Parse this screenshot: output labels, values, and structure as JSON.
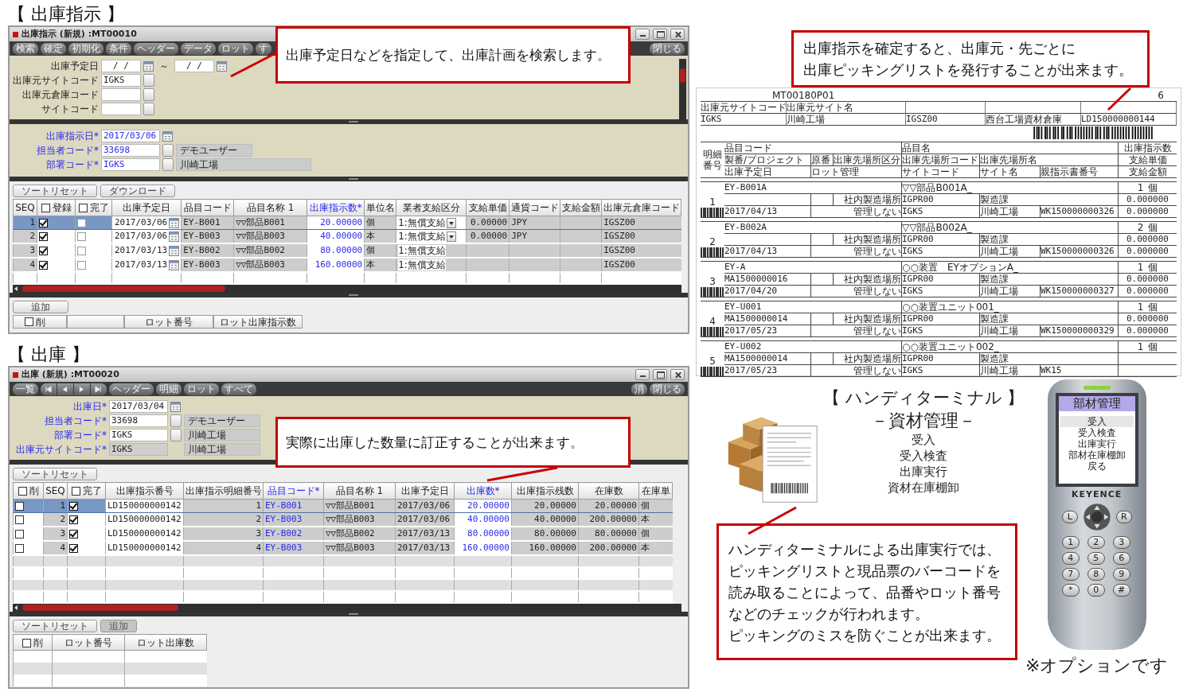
{
  "instruction": {
    "heading": "【 出庫指示 】",
    "title": "出庫指示 (新規) :MT00010",
    "toolbar": [
      "検索",
      "確定",
      "初期化",
      "条件",
      "ヘッダー",
      "データ",
      "ロット",
      "す"
    ],
    "close_button": "閉じる",
    "search_fields": [
      {
        "kind": "range",
        "label": "出庫予定日",
        "value": "/ /",
        "separator": "～",
        "value_to": "/ /"
      },
      {
        "kind": "lookup",
        "label": "出庫元サイトコード",
        "value": "IGKS"
      },
      {
        "kind": "lookup",
        "label": "出庫元倉庫コード"
      },
      {
        "kind": "lookup",
        "label": "サイトコード"
      }
    ],
    "header_fields": [
      {
        "kind": "date",
        "label": "出庫指示日*",
        "value": "2017/03/06"
      },
      {
        "kind": "lookup",
        "label": "担当者コード*",
        "value": "33698",
        "name": "デモユーザー"
      },
      {
        "kind": "lookup",
        "label": "部署コード*",
        "value": "IGKS",
        "name": "川崎工場"
      }
    ],
    "grid_buttons": [
      "ソートリセット",
      "ダウンロード"
    ],
    "columns": [
      {
        "kind": "text",
        "label": "SEQ",
        "required": false
      },
      {
        "kind": "check",
        "label": "登録",
        "checked": false,
        "required": false
      },
      {
        "kind": "check",
        "label": "完了",
        "checked": false,
        "required": false
      },
      {
        "kind": "text",
        "label": "出庫予定日",
        "required": false
      },
      {
        "kind": "text",
        "label": "品目コード",
        "required": false
      },
      {
        "kind": "text",
        "label": "品目名称 1",
        "required": false
      },
      {
        "kind": "text",
        "label": "出庫指示数*",
        "required": true
      },
      {
        "kind": "text",
        "label": "単位名",
        "required": false
      },
      {
        "kind": "text",
        "label": "業者支給区分",
        "required": false
      },
      {
        "kind": "text",
        "label": "支給単価",
        "required": false
      },
      {
        "kind": "text",
        "label": "通貨コード",
        "required": false
      },
      {
        "kind": "text",
        "label": "支給金額",
        "required": false
      },
      {
        "kind": "text",
        "label": "出庫元倉庫コード",
        "required": false
      }
    ],
    "rows": [
      {
        "selected": true,
        "seq": "1",
        "registered": true,
        "done": false,
        "date": "2017/03/06",
        "item_code": "EY-B001",
        "item_name": "▽▽部品B001",
        "quantity": "20.00000",
        "unit": "個",
        "supply_type": "1:無償支給",
        "dropdown": true,
        "unit_price": "0.00000",
        "currency": "JPY",
        "warehouse": "IGSZ00"
      },
      {
        "selected": false,
        "seq": "2",
        "registered": true,
        "done": false,
        "date": "2017/03/06",
        "item_code": "EY-B003",
        "item_name": "▽▽部品B003",
        "quantity": "40.00000",
        "unit": "本",
        "supply_type": "1:無償支給",
        "dropdown": true,
        "unit_price": "0.00000",
        "currency": "JPY",
        "warehouse": "IGSZ00"
      },
      {
        "selected": false,
        "seq": "3",
        "registered": true,
        "done": false,
        "date": "2017/03/13",
        "item_code": "EY-B002",
        "item_name": "▽▽部品B002",
        "quantity": "80.00000",
        "unit": "個",
        "supply_type": "1:無償支給",
        "dropdown": false,
        "warehouse": "IGSZ00"
      },
      {
        "selected": false,
        "seq": "4",
        "registered": true,
        "done": false,
        "date": "2017/03/13",
        "item_code": "EY-B003",
        "item_name": "▽▽部品B003",
        "quantity": "160.00000",
        "unit": "本",
        "supply_type": "1:無償支給",
        "dropdown": false,
        "warehouse": "IGSZ00"
      }
    ],
    "add_button": "追加",
    "lot_columns": [
      {
        "kind": "check",
        "label": "削",
        "checked": false
      },
      {
        "kind": "blank"
      },
      {
        "kind": "text",
        "label": "ロット番号"
      },
      {
        "kind": "text",
        "label": "ロット出庫指示数"
      }
    ]
  },
  "shipping": {
    "heading": "【 出庫 】",
    "title": "出庫 (新規) :MT00020",
    "toolbar": [
      "一覧"
    ],
    "toolbar_more": [
      "ヘッダー",
      "明細",
      "ロット",
      "すべて"
    ],
    "right_buttons": [
      "消",
      "閉じる"
    ],
    "fields": [
      {
        "kind": "date",
        "label": "出庫日*",
        "value": "2017/03/04"
      },
      {
        "kind": "lookup",
        "label": "担当者コード*",
        "value": "33698",
        "name": "デモユーザー"
      },
      {
        "kind": "lookup",
        "label": "部署コード*",
        "value": "IGKS",
        "name": "川崎工場"
      },
      {
        "kind": "readonly",
        "label": "出庫元サイトコード*",
        "value": "IGKS",
        "name": "川崎工場"
      }
    ],
    "grid_buttons": [
      "ソートリセット"
    ],
    "columns": [
      {
        "kind": "check",
        "label": "削",
        "checked": false,
        "required": false
      },
      {
        "kind": "text",
        "label": "SEQ",
        "required": false
      },
      {
        "kind": "check",
        "label": "完了",
        "checked": false,
        "required": false
      },
      {
        "kind": "text",
        "label": "出庫指示番号",
        "required": false
      },
      {
        "kind": "text",
        "label": "出庫指示明細番号",
        "required": false
      },
      {
        "kind": "text",
        "label": "品目コード*",
        "required": true
      },
      {
        "kind": "text",
        "label": "品目名称 1",
        "required": false
      },
      {
        "kind": "text",
        "label": "出庫予定日",
        "required": false
      },
      {
        "kind": "text",
        "label": "出庫数*",
        "required": true
      },
      {
        "kind": "text",
        "label": "出庫指示残数",
        "required": false
      },
      {
        "kind": "text",
        "label": "在庫数",
        "required": false
      },
      {
        "kind": "text",
        "label": "在庫単",
        "required": false
      }
    ],
    "rows": [
      {
        "selected": true,
        "delete": false,
        "seq": "1",
        "done": true,
        "instruction_no": "LD150000000142",
        "line_no": "1",
        "item_code": "EY-B001",
        "item_name": "▽▽部品B001",
        "date": "2017/03/06",
        "quantity": "20.00000",
        "remaining": "20.00000",
        "stock": "20.00000",
        "unit": "個"
      },
      {
        "selected": false,
        "delete": false,
        "seq": "2",
        "done": true,
        "instruction_no": "LD150000000142",
        "line_no": "2",
        "item_code": "EY-B003",
        "item_name": "▽▽部品B003",
        "date": "2017/03/06",
        "quantity": "40.00000",
        "remaining": "40.00000",
        "stock": "200.00000",
        "unit": "本"
      },
      {
        "selected": false,
        "delete": false,
        "seq": "3",
        "done": true,
        "instruction_no": "LD150000000142",
        "line_no": "3",
        "item_code": "EY-B002",
        "item_name": "▽▽部品B002",
        "date": "2017/03/13",
        "quantity": "80.00000",
        "remaining": "80.00000",
        "stock": "80.00000",
        "unit": "個"
      },
      {
        "selected": false,
        "delete": false,
        "seq": "4",
        "done": true,
        "instruction_no": "LD150000000142",
        "line_no": "4",
        "item_code": "EY-B003",
        "item_name": "▽▽部品B003",
        "date": "2017/03/13",
        "quantity": "160.00000",
        "remaining": "160.00000",
        "stock": "200.00000",
        "unit": "本"
      }
    ],
    "lot_buttons": [
      {
        "label": "ソートリセット",
        "disabled": false
      },
      {
        "label": "追加",
        "disabled": true
      }
    ],
    "lot_columns": [
      {
        "kind": "check",
        "label": "削",
        "checked": false
      },
      {
        "kind": "text",
        "label": "ロット番号"
      },
      {
        "kind": "text",
        "label": "ロット出庫数"
      }
    ]
  },
  "callouts": [
    {
      "lines": [
        "出庫予定日などを指定して、出庫計画を検索します。"
      ]
    },
    {
      "lines": [
        "実際に出庫した数量に訂正することが出来ます。"
      ]
    },
    {
      "lines": [
        "出庫指示を確定すると、出庫元・先ごとに",
        "出庫ピッキングリストを発行することが出来ます。"
      ]
    },
    {
      "lines": [
        "ハンディターミナルによる出庫実行では、",
        "ピッキングリストと現品票のバーコードを",
        "読み取ることによって、品番やロット番号",
        "などのチェックが行われます。",
        "ピッキングのミスを防ぐことが出来ます。"
      ]
    }
  ],
  "picking_list": {
    "form_id": "MT00180P01",
    "page": "6",
    "header_labels": [
      "出庫元サイトコード",
      "出庫元サイト名"
    ],
    "header_values": [
      "IGKS",
      "川崎工場",
      "IGSZ00",
      "西台工場資材倉庫",
      "LD150000000144"
    ],
    "line_label": "明細番号",
    "column_labels": {
      "item_code": "品目コード",
      "item_name": "品目名",
      "qty": "出庫指示数",
      "project": "製番/プロジェクト",
      "kind": "原番",
      "place_type": "出庫先場所区分",
      "place_code": "出庫先場所コード",
      "place_name": "出庫先場所名",
      "price": "支給単価",
      "date": "出庫予定日",
      "lot": "ロット管理",
      "site_code": "サイトコード",
      "site_name": "サイト名",
      "parent_no": "親指示書番号",
      "amount": "支給金額"
    },
    "items": [
      {
        "no": "1",
        "item_code": "EY-B001A",
        "item_name": "▽▽部品B001A_",
        "qty": "1",
        "unit": "個",
        "place_type": "社内製造場所",
        "place_code": "IGPR00",
        "place_name": "製造課",
        "price": "0.000000",
        "date": "2017/04/13",
        "lot": "管理しない",
        "site_code": "IGKS",
        "site_name": "川崎工場",
        "parent_no": "WK150000000326",
        "amount": "0.000000"
      },
      {
        "no": "2",
        "item_code": "EY-B002A",
        "item_name": "▽▽部品B002A_",
        "qty": "2",
        "unit": "個",
        "place_type": "社内製造場所",
        "place_code": "IGPR00",
        "place_name": "製造課",
        "price": "0.000000",
        "date": "2017/04/13",
        "lot": "管理しない",
        "site_code": "IGKS",
        "site_name": "川崎工場",
        "parent_no": "WK150000000326",
        "amount": "0.000000"
      },
      {
        "no": "3",
        "item_code": "EY-A",
        "item_name": "○○装置　EYオプションA_",
        "qty": "1",
        "unit": "個",
        "project": "MA1500000016",
        "place_type": "社内製造場所",
        "place_code": "IGPR00",
        "place_name": "製造課",
        "price": "0.000000",
        "date": "2017/04/20",
        "lot": "管理しない",
        "site_code": "IGKS",
        "site_name": "川崎工場",
        "parent_no": "WK150000000327",
        "amount": "0.000000"
      },
      {
        "no": "4",
        "item_code": "EY-U001",
        "item_name": "○○装置ユニット001_",
        "qty": "1",
        "unit": "個",
        "project": "MA1500000014",
        "place_type": "社内製造場所",
        "place_code": "IGPR00",
        "place_name": "製造課",
        "price": "0.000000",
        "date": "2017/05/23",
        "lot": "管理しない",
        "site_code": "IGKS",
        "site_name": "川崎工場",
        "parent_no": "WK150000000329",
        "amount": "0.000000"
      },
      {
        "no": "5",
        "item_code": "EY-U002",
        "item_name": "○○装置ユニット002_",
        "qty": "1",
        "unit": "個",
        "project": "MA1500000014",
        "place_type": "社内製造場所",
        "place_code": "IGPR00",
        "place_name": "製造課",
        "date": "2017/05/23",
        "lot": "管理しない",
        "site_code": "IGKS",
        "site_name": "川崎工場",
        "parent_no": "WK15"
      }
    ]
  },
  "handy": {
    "heading": "【 ハンディターミナル 】",
    "subheading": "－資材管理－",
    "features": [
      "受入",
      "受入検査",
      "出庫実行",
      "資材在庫棚卸"
    ]
  },
  "device": {
    "screen_title": "部材管理",
    "menu": [
      {
        "label": "受入",
        "selected": true
      },
      {
        "label": "受入検査",
        "selected": false
      },
      {
        "label": "出庫実行",
        "selected": false
      },
      {
        "label": "部材在庫棚卸",
        "selected": false
      },
      {
        "label": "戻る",
        "selected": false
      }
    ],
    "brand": "KEYENCE",
    "side_keys": [
      "L",
      "R"
    ],
    "keys": [
      "1",
      "2",
      "3",
      "4",
      "5",
      "6",
      "7",
      "8",
      "9",
      "*",
      "0",
      "#"
    ]
  },
  "note": "※オプションです"
}
